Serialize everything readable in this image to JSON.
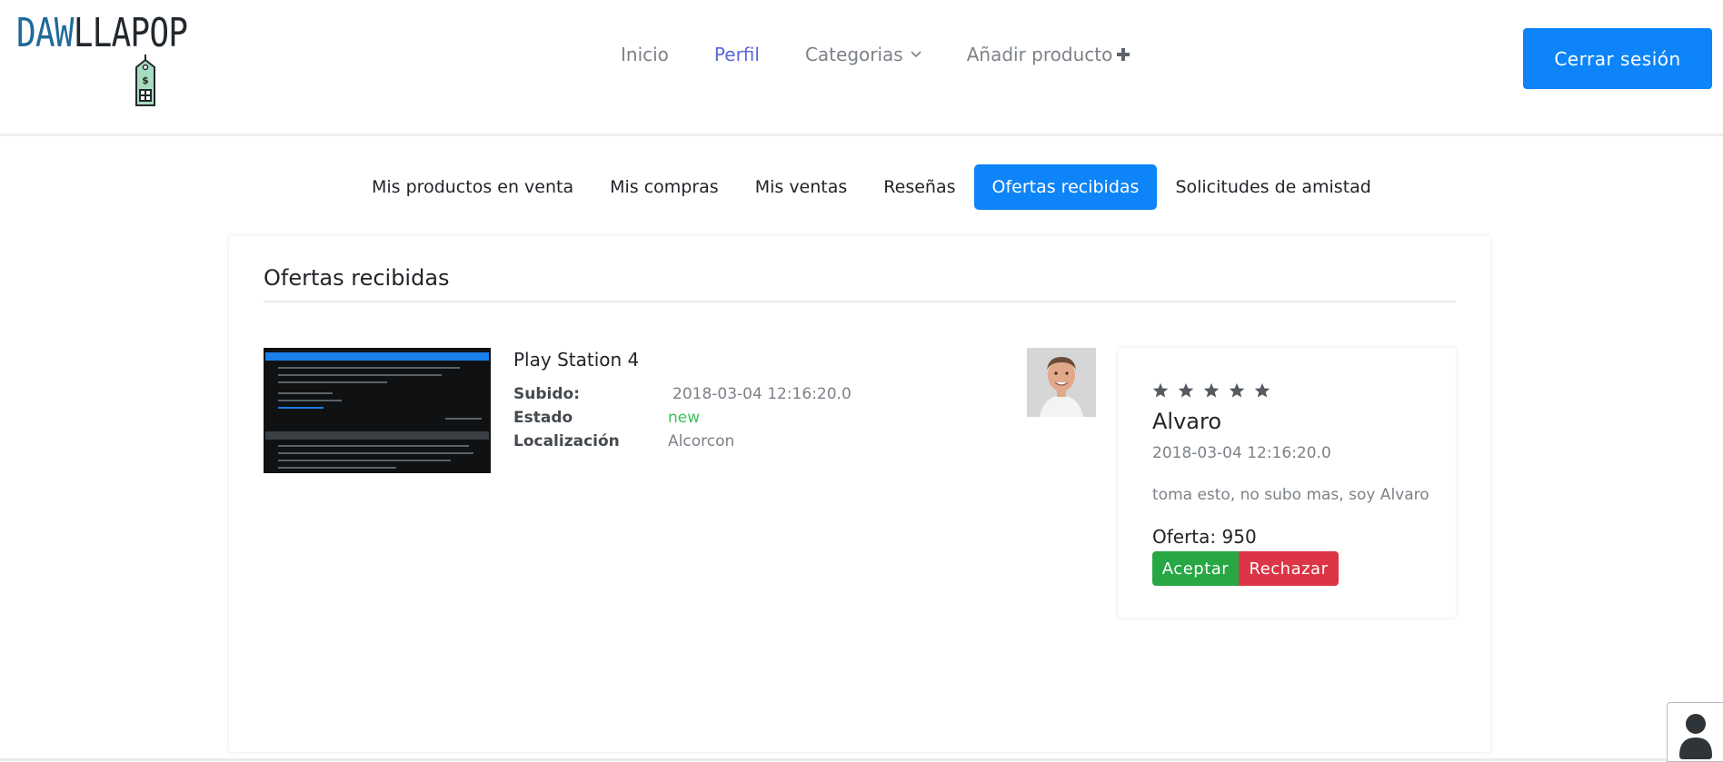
{
  "header": {
    "logo": {
      "part1": "DAW",
      "part2": "LLAPOP"
    },
    "nav": [
      {
        "label": "Inicio",
        "active": false
      },
      {
        "label": "Perfil",
        "active": true
      },
      {
        "label": "Categorias",
        "active": false,
        "icon": "chevron-down-icon"
      },
      {
        "label": "Añadir producto",
        "active": false,
        "icon": "plus-icon"
      }
    ],
    "logout_label": "Cerrar sesión"
  },
  "tabs": [
    {
      "label": "Mis productos en venta",
      "active": false
    },
    {
      "label": "Mis compras",
      "active": false
    },
    {
      "label": "Mis ventas",
      "active": false
    },
    {
      "label": "Reseñas",
      "active": false
    },
    {
      "label": "Ofertas recibidas",
      "active": true
    },
    {
      "label": "Solicitudes de amistad",
      "active": false
    }
  ],
  "offers": {
    "title": "Ofertas recibidas",
    "product": {
      "name": "Play Station 4",
      "details": [
        {
          "key": "Subido:",
          "value": "2018-03-04 12:16:20.0"
        },
        {
          "key": "Estado",
          "value": "new"
        },
        {
          "key": "Localización",
          "value": "Alcorcon"
        }
      ]
    },
    "review": {
      "rating": 5,
      "name": "Alvaro",
      "date": "2018-03-04 12:16:20.0",
      "text": "toma esto, no subo mas, soy Alvaro",
      "offer": "Oferta: 950",
      "accept_label": "Aceptar",
      "reject_label": "Rechazar"
    }
  },
  "colors": {
    "primary": "#0d84f7",
    "nav_active": "#5a68d8",
    "success": "#28a745",
    "danger": "#dc3545",
    "state_new": "#3cc35a"
  }
}
